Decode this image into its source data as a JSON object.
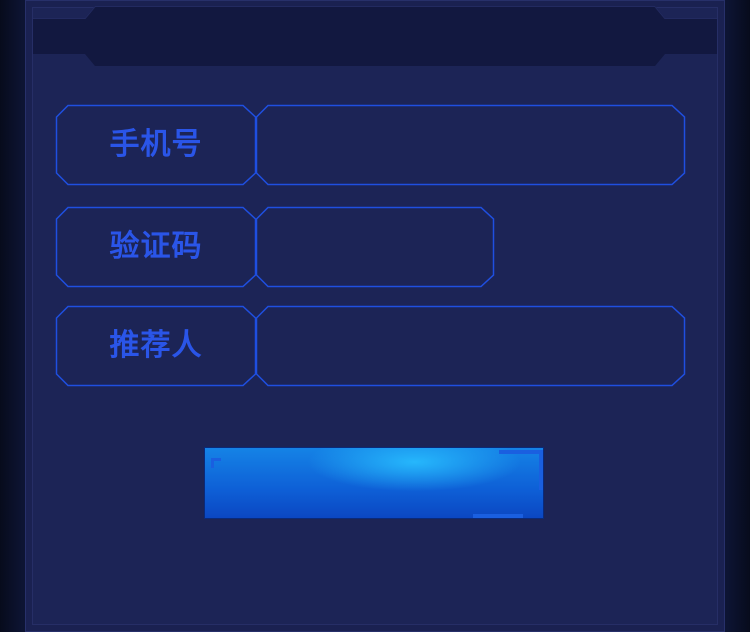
{
  "form": {
    "fields": [
      {
        "label": "手机号",
        "value": "",
        "placeholder": ""
      },
      {
        "label": "验证码",
        "value": "",
        "placeholder": ""
      },
      {
        "label": "推荐人",
        "value": "",
        "placeholder": ""
      }
    ],
    "submit_label": ""
  },
  "colors": {
    "background": "#0d1433",
    "panel": "#1c2456",
    "header_band": "#121840",
    "accent_border": "#1f4fe0",
    "label_text": "#2a55e8",
    "button_top": "#1583e6",
    "button_bottom": "#0b47c2"
  }
}
